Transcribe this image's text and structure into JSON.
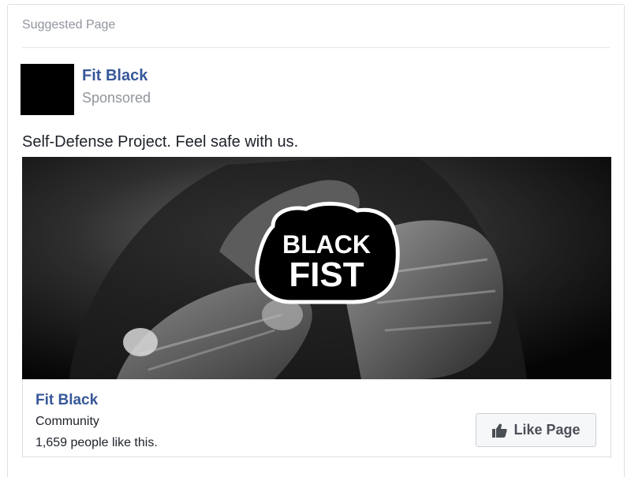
{
  "header": {
    "label": "Suggested Page"
  },
  "post": {
    "page_name": "Fit Black",
    "sponsored_label": "Sponsored",
    "text": "Self-Defense Project. Feel safe with us."
  },
  "image": {
    "logo_line1": "BLACK",
    "logo_line2": "FIST"
  },
  "footer": {
    "page_name": "Fit Black",
    "category": "Community",
    "likes": "1,659 people like this.",
    "like_button_label": "Like Page",
    "like_icon": "thumbs-up-icon"
  },
  "colors": {
    "link_blue": "#365899",
    "secondary_gray": "#90949c",
    "button_bg": "#f6f7f9"
  }
}
